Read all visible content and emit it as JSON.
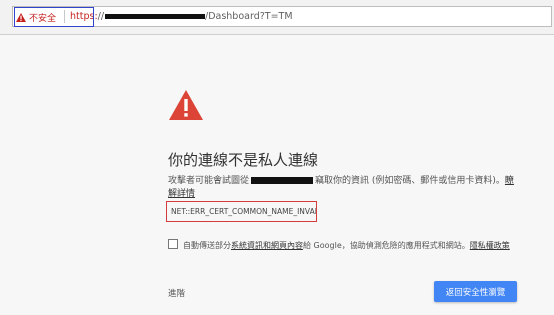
{
  "address_bar": {
    "security_label": "不安全",
    "url_scheme": "https:",
    "url_slashes": "//",
    "url_suffix": "/Dashboard?T=TM"
  },
  "icons": {
    "chip": "warning-triangle-icon",
    "main": "warning-triangle-icon"
  },
  "colors": {
    "warning_red": "#db4437",
    "insecure_red": "#c5221f",
    "button_blue": "#4285f4",
    "error_box_border": "#d23c3c",
    "url_annotation_border": "#3344cc"
  },
  "interstitial": {
    "heading": "你的連線不是私人連線",
    "description_before": "攻擊者可能會試圖從",
    "description_after": "竊取你的資訊 (例如密碼、郵件或信用卡資料)。",
    "learn_more": "瞭解詳情",
    "error_code": "NET::ERR_CERT_COMMON_NAME_INVALID",
    "optin_before": "自動傳送部分",
    "optin_link": "系統資訊和網頁內容",
    "optin_after": "給 Google，協助偵測危險的應用程式和網站。",
    "privacy_link": "隱私權政策",
    "details_label": "進階",
    "back_button_label": "返回安全性瀏覽"
  }
}
